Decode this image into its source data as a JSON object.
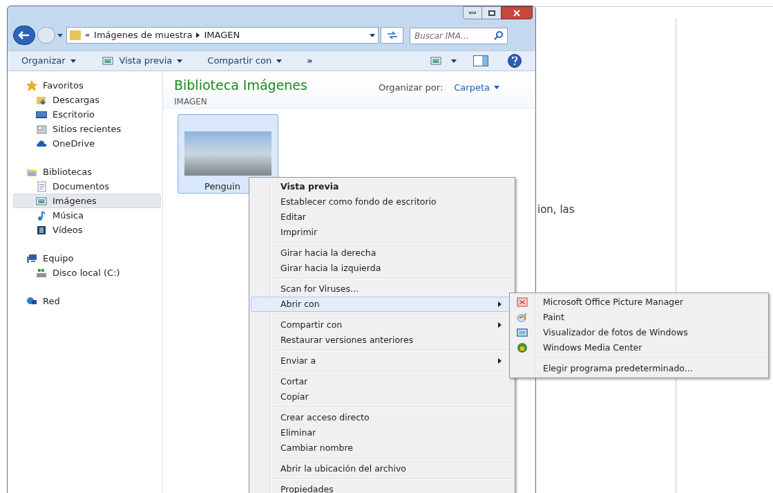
{
  "address_bar": {
    "overflow": "«",
    "segments": [
      "Imágenes de muestra",
      "IMAGEN"
    ]
  },
  "search": {
    "placeholder": "Buscar IMA..."
  },
  "toolbar": {
    "items": [
      {
        "label": "Organizar",
        "kind": "menu"
      },
      {
        "label": "Vista previa",
        "kind": "icon-menu"
      },
      {
        "label": "Compartir con",
        "kind": "menu"
      },
      {
        "label": "»",
        "kind": "more"
      }
    ]
  },
  "nav": [
    {
      "label": "Favoritos",
      "selected": false,
      "children": [
        {
          "label": "Descargas",
          "selected": false
        },
        {
          "label": "Escritorio",
          "selected": false
        },
        {
          "label": "Sitios recientes",
          "selected": false
        },
        {
          "label": "OneDrive",
          "selected": false
        }
      ]
    },
    {
      "label": "Bibliotecas",
      "selected": false,
      "children": [
        {
          "label": "Documentos",
          "selected": false
        },
        {
          "label": "Imágenes",
          "selected": true
        },
        {
          "label": "Música",
          "selected": false
        },
        {
          "label": "Vídeos",
          "selected": false
        }
      ]
    },
    {
      "label": "Equipo",
      "selected": false,
      "children": [
        {
          "label": "Disco local (C:)",
          "selected": false
        }
      ]
    },
    {
      "label": "Red",
      "selected": false
    }
  ],
  "library": {
    "title": "Biblioteca Imágenes",
    "subtitle": "IMAGEN",
    "arrange_label": "Organizar por:",
    "arrange_value": "Carpeta"
  },
  "files": [
    {
      "name": "Penguin",
      "selected": true
    }
  ],
  "context_menu": {
    "groups": [
      [
        {
          "label": "Vista previa",
          "default": true,
          "submenu": false,
          "selected": false
        },
        {
          "label": "Establecer como fondo de escritorio",
          "default": false,
          "submenu": false,
          "selected": false
        },
        {
          "label": "Editar",
          "default": false,
          "submenu": false,
          "selected": false
        },
        {
          "label": "Imprimir",
          "default": false,
          "submenu": false,
          "selected": false
        }
      ],
      [
        {
          "label": "Girar hacia la derecha",
          "default": false,
          "submenu": false,
          "selected": false
        },
        {
          "label": "Girar hacia la izquierda",
          "default": false,
          "submenu": false,
          "selected": false
        }
      ],
      [
        {
          "label": "Scan for Viruses...",
          "default": false,
          "submenu": false,
          "selected": false
        },
        {
          "label": "Abrir con",
          "default": false,
          "submenu": true,
          "selected": true
        }
      ],
      [
        {
          "label": "Compartir con",
          "default": false,
          "submenu": true,
          "selected": false
        },
        {
          "label": "Restaurar versiones anteriores",
          "default": false,
          "submenu": false,
          "selected": false
        }
      ],
      [
        {
          "label": "Enviar a",
          "default": false,
          "submenu": true,
          "selected": false
        }
      ],
      [
        {
          "label": "Cortar",
          "default": false,
          "submenu": false,
          "selected": false
        },
        {
          "label": "Copiar",
          "default": false,
          "submenu": false,
          "selected": false
        }
      ],
      [
        {
          "label": "Crear acceso directo",
          "default": false,
          "submenu": false,
          "selected": false
        },
        {
          "label": "Eliminar",
          "default": false,
          "submenu": false,
          "selected": false
        },
        {
          "label": "Cambiar nombre",
          "default": false,
          "submenu": false,
          "selected": false
        }
      ],
      [
        {
          "label": "Abrir la ubicación del archivo",
          "default": false,
          "submenu": false,
          "selected": false
        }
      ],
      [
        {
          "label": "Propiedades",
          "default": false,
          "submenu": false,
          "selected": false
        }
      ]
    ]
  },
  "submenu": {
    "groups": [
      [
        "Microsoft Office Picture Manager",
        "Paint",
        "Visualizador de fotos de Windows",
        "Windows Media Center"
      ],
      [
        "Elegir programa predeterminado..."
      ]
    ]
  },
  "background_document": {
    "lines": [
      "ion, las"
    ]
  }
}
